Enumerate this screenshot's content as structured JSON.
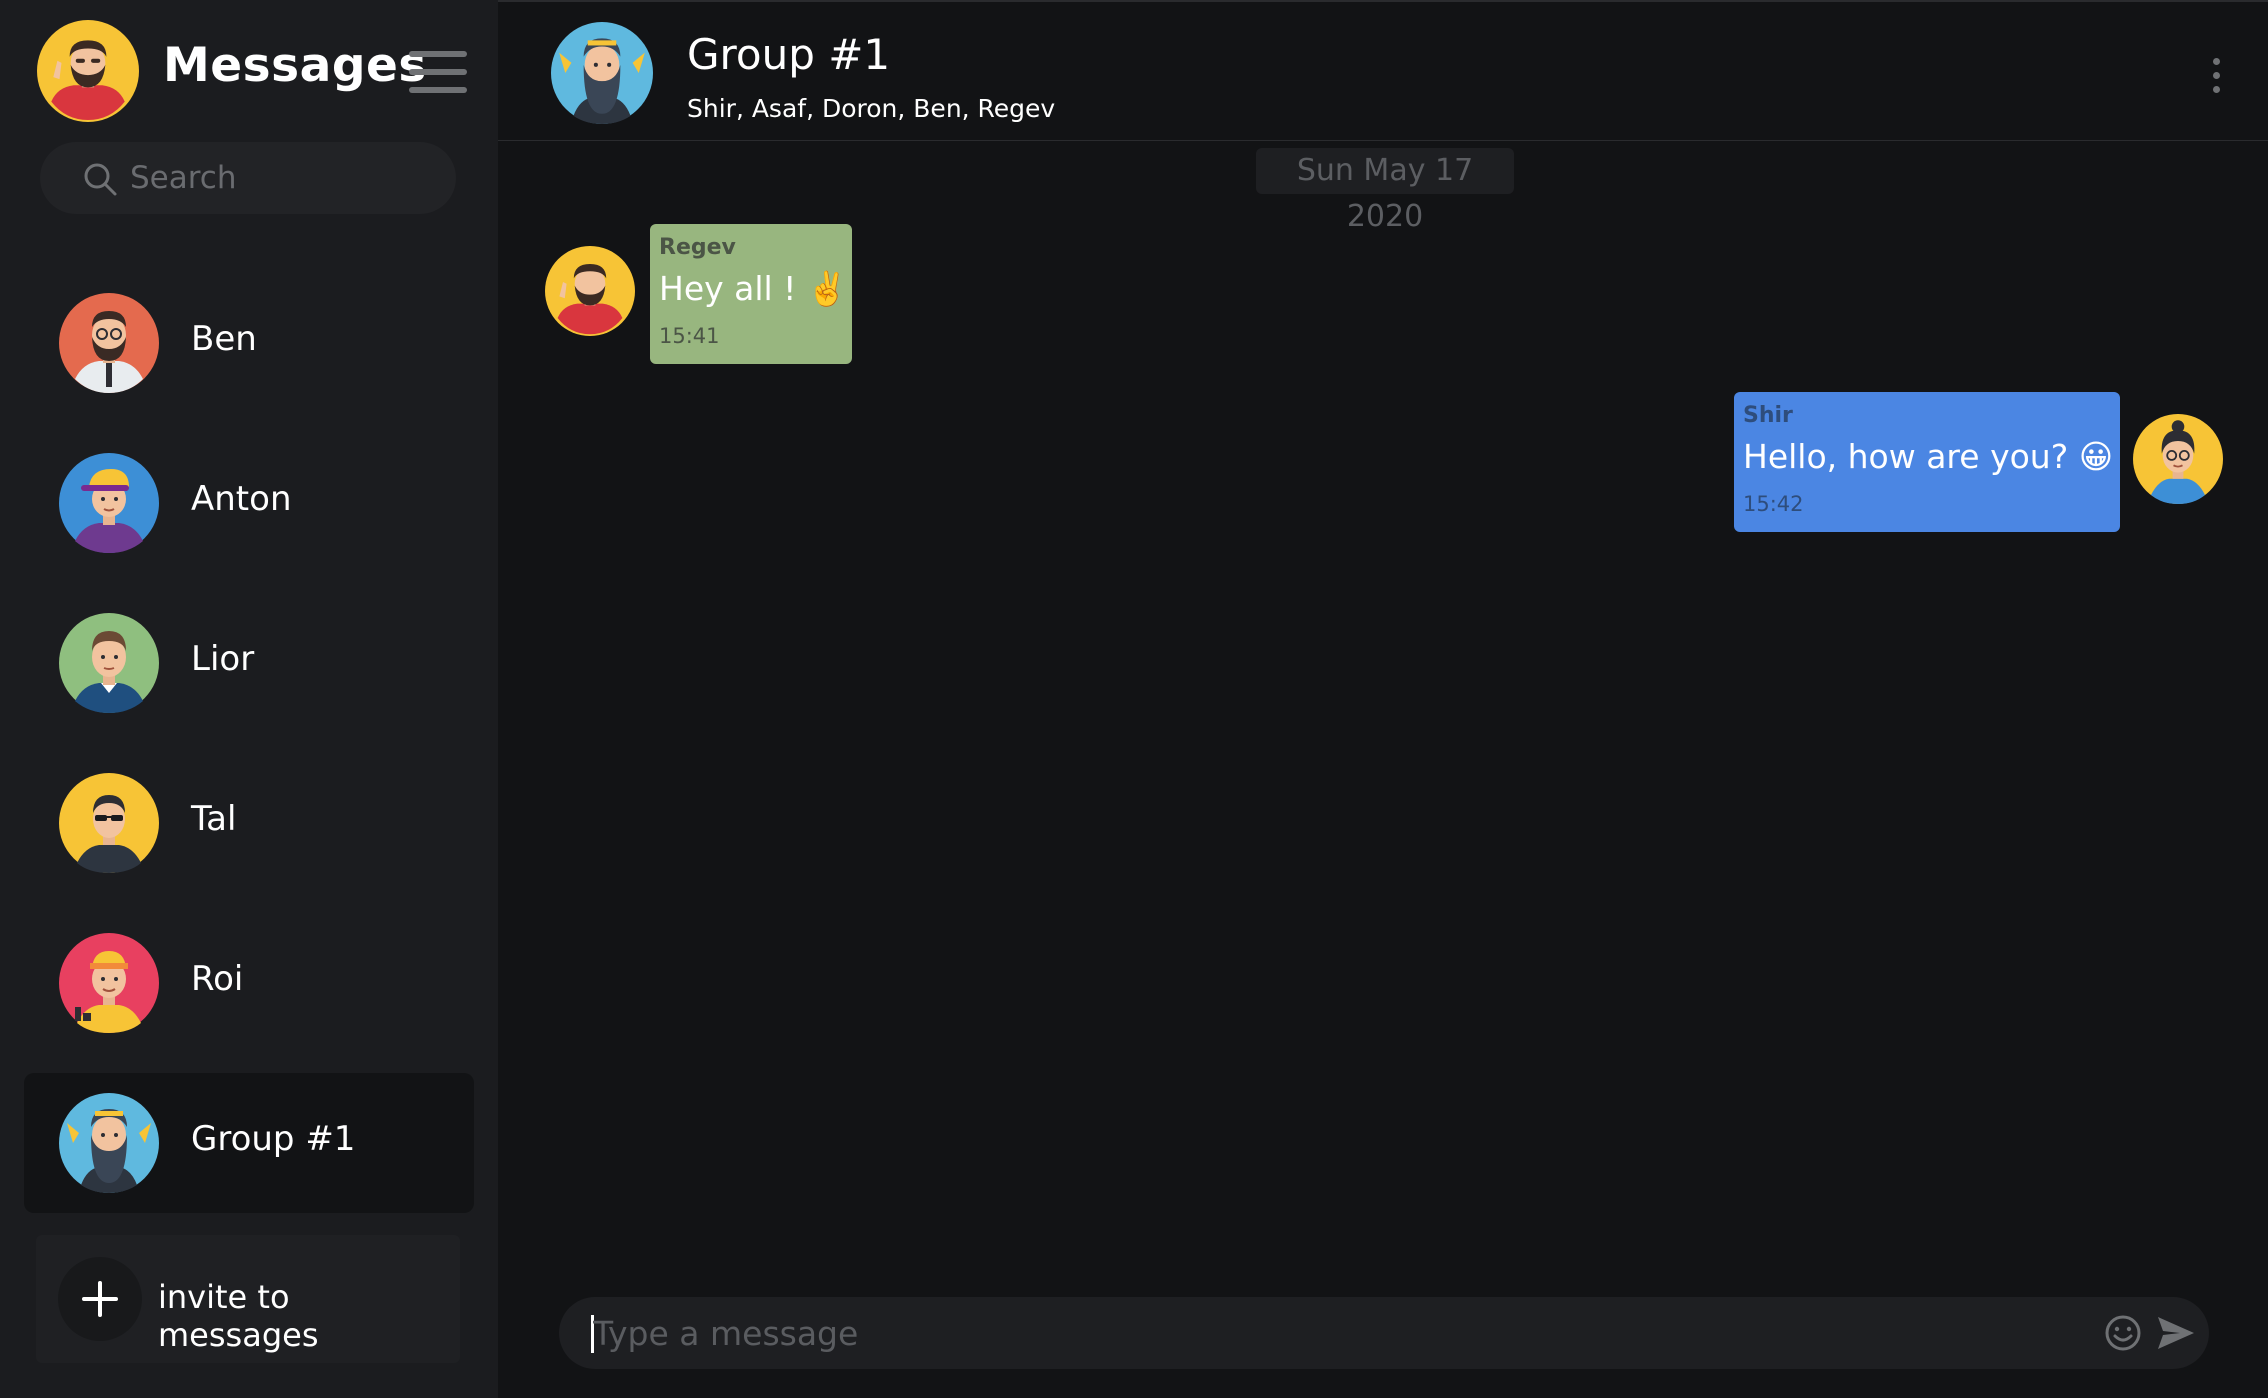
{
  "sidebar": {
    "title": "Messages",
    "search": {
      "placeholder": "Search"
    },
    "contacts": [
      {
        "name": "Ben"
      },
      {
        "name": "Anton"
      },
      {
        "name": "Lior"
      },
      {
        "name": "Tal"
      },
      {
        "name": "Roi"
      },
      {
        "name": "Group #1",
        "active": true
      }
    ],
    "invite_label": "invite to messages"
  },
  "chat": {
    "title": "Group #1",
    "members": "Shir, Asaf, Doron, Ben, Regev",
    "date": "Sun May 17 2020",
    "messages": [
      {
        "sender": "Regev",
        "text": "Hey all ! ✌️",
        "time": "15:41",
        "side": "left",
        "bubble_color": "#98b67f"
      },
      {
        "sender": "Shir",
        "text": "Hello, how are you? 😀",
        "time": "15:42",
        "side": "right",
        "bubble_color": "#4b86e3"
      }
    ],
    "composer": {
      "placeholder": "Type a message"
    }
  },
  "colors": {
    "sidebar_bg": "#1b1c1f",
    "main_bg": "#121315",
    "incoming_bubble": "#98b67f",
    "outgoing_bubble": "#4b86e3"
  },
  "icons": [
    "hamburger-menu-icon",
    "search-icon",
    "kebab-menu-icon",
    "plus-icon",
    "emoji-icon",
    "send-icon"
  ]
}
